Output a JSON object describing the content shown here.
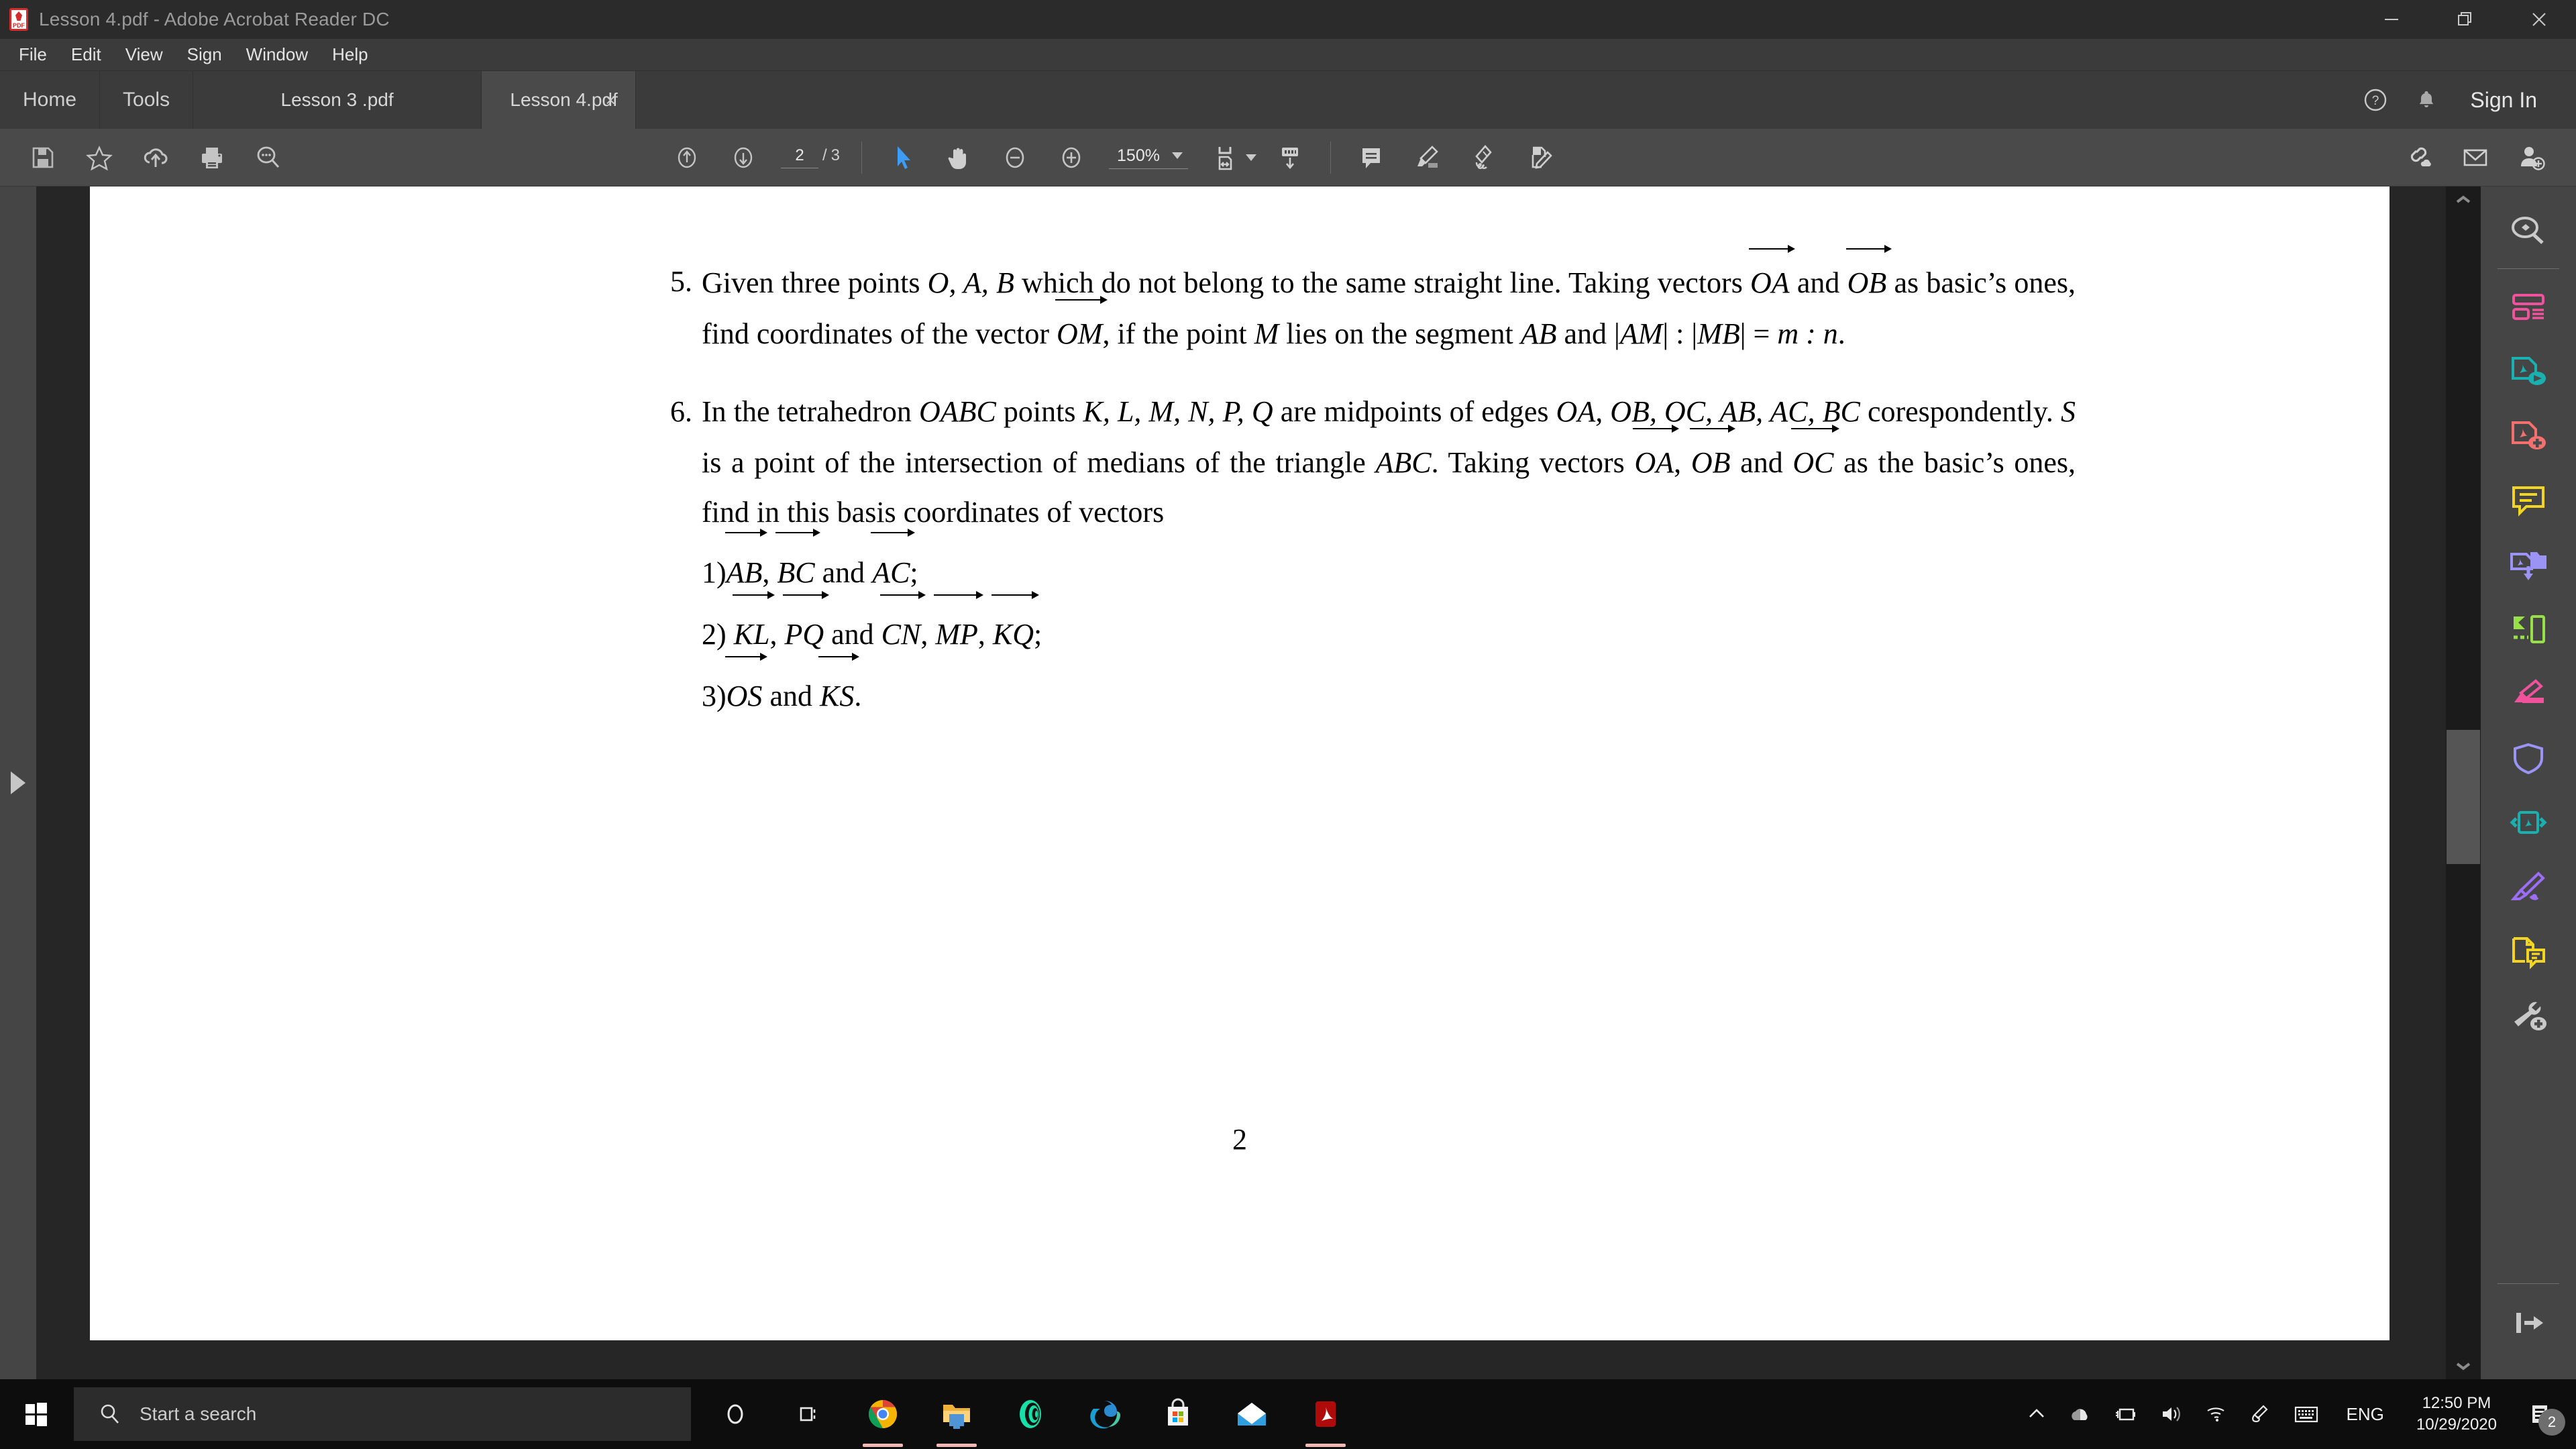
{
  "window": {
    "title": "Lesson 4.pdf - Adobe Acrobat Reader DC",
    "app_icon": "pdf-file-icon",
    "minimize_label": "—",
    "maximize_label": "❐",
    "close_label": "✕"
  },
  "menu": {
    "items": [
      "File",
      "Edit",
      "View",
      "Sign",
      "Window",
      "Help"
    ]
  },
  "tabs": {
    "home_label": "Home",
    "tools_label": "Tools",
    "documents": [
      {
        "label": "Lesson 3 .pdf",
        "active": false
      },
      {
        "label": "Lesson 4.pdf",
        "active": true,
        "close_label": "×"
      }
    ],
    "help_icon": "help-circle-icon",
    "bell_icon": "notification-bell-icon",
    "sign_in_label": "Sign In"
  },
  "toolbar": {
    "left_icons": [
      "save-icon",
      "star-icon",
      "cloud-upload-icon",
      "print-icon",
      "search-icon"
    ],
    "page_current": "2",
    "page_separator": "/",
    "page_total": "3",
    "nav_up_icon": "arrow-up-circle-icon",
    "nav_down_icon": "arrow-down-circle-icon",
    "select_tool_icon": "cursor-select-icon",
    "hand_tool_icon": "hand-pan-icon",
    "zoom_out_icon": "zoom-out-icon",
    "zoom_in_icon": "zoom-in-icon",
    "zoom_value": "150%",
    "fit_page_icon": "fit-page-icon",
    "scroll_mode_icon": "scroll-mode-icon",
    "comment_icon": "comment-icon",
    "highlight_icon": "highlighter-icon",
    "draw_icon": "sign-pen-icon",
    "fill_sign_icon": "fill-and-sign-icon",
    "share_link_icon": "share-link-icon",
    "email_icon": "email-icon",
    "add_person_icon": "add-person-icon"
  },
  "right_panel": {
    "tools": [
      {
        "name": "search-document-icon",
        "color": "#c9c9c9"
      },
      {
        "name": "export-pdf-icon",
        "color": "#f0529c"
      },
      {
        "name": "create-pdf-icon",
        "color": "#1ab0b0"
      },
      {
        "name": "edit-pdf-icon",
        "color": "#f2706d"
      },
      {
        "name": "comment-tool-icon",
        "color": "#f2d522"
      },
      {
        "name": "combine-files-icon",
        "color": "#9b94f5"
      },
      {
        "name": "organize-pages-icon",
        "color": "#98e048"
      },
      {
        "name": "redact-icon",
        "color": "#f0529c"
      },
      {
        "name": "protect-icon",
        "color": "#9b94f5"
      },
      {
        "name": "compress-pdf-icon",
        "color": "#1ab0b0"
      },
      {
        "name": "fill-sign-tool-icon",
        "color": "#9b6ef5"
      },
      {
        "name": "request-signature-icon",
        "color": "#f2d522"
      },
      {
        "name": "more-tools-icon",
        "color": "#c9c9c9"
      }
    ],
    "collapse_icon": "collapse-panel-icon"
  },
  "document": {
    "problems": [
      {
        "number": "5.",
        "segments": [
          {
            "t": "Given three points ",
            "k": "r"
          },
          {
            "t": "O, A, B",
            "k": "i"
          },
          {
            "t": " which do not belong to the same straight line. Taking vectors ",
            "k": "r"
          },
          {
            "t": "OA",
            "k": "v"
          },
          {
            "t": " and ",
            "k": "r"
          },
          {
            "t": "OB",
            "k": "v"
          },
          {
            "t": " as basic’s ones, find coordinates of the vector ",
            "k": "r"
          },
          {
            "t": "OM",
            "k": "v"
          },
          {
            "t": ", if the point ",
            "k": "r"
          },
          {
            "t": "M",
            "k": "i"
          },
          {
            "t": " lies on the segment ",
            "k": "r"
          },
          {
            "t": "AB",
            "k": "i"
          },
          {
            "t": " and |",
            "k": "r"
          },
          {
            "t": "AM",
            "k": "i"
          },
          {
            "t": "| : |",
            "k": "r"
          },
          {
            "t": "MB",
            "k": "i"
          },
          {
            "t": "| = ",
            "k": "r"
          },
          {
            "t": "m : n",
            "k": "i"
          },
          {
            "t": ".",
            "k": "r"
          }
        ]
      },
      {
        "number": "6.",
        "segments": [
          {
            "t": "In the tetrahedron ",
            "k": "r"
          },
          {
            "t": "OABC",
            "k": "i"
          },
          {
            "t": " points ",
            "k": "r"
          },
          {
            "t": "K, L, M, N, P, Q",
            "k": "i"
          },
          {
            "t": " are midpoints of edges ",
            "k": "r"
          },
          {
            "t": "OA, OB, OC, AB, AC, BC",
            "k": "i"
          },
          {
            "t": " corespondently. ",
            "k": "r"
          },
          {
            "t": "S",
            "k": "i"
          },
          {
            "t": " is a point of the intersection of medians of the triangle ",
            "k": "r"
          },
          {
            "t": "ABC",
            "k": "i"
          },
          {
            "t": ". Taking vectors ",
            "k": "r"
          },
          {
            "t": "OA",
            "k": "v"
          },
          {
            "t": ", ",
            "k": "r"
          },
          {
            "t": "OB",
            "k": "v"
          },
          {
            "t": " and ",
            "k": "r"
          },
          {
            "t": "OC",
            "k": "v"
          },
          {
            "t": " as the basic’s ones, find in this basis coordinates of vectors",
            "k": "r"
          }
        ],
        "subitems": [
          {
            "segments": [
              {
                "t": "1)",
                "k": "r"
              },
              {
                "t": "AB",
                "k": "v"
              },
              {
                "t": ", ",
                "k": "r"
              },
              {
                "t": "BC",
                "k": "v"
              },
              {
                "t": " and ",
                "k": "r"
              },
              {
                "t": "AC",
                "k": "v"
              },
              {
                "t": ";",
                "k": "r"
              }
            ]
          },
          {
            "segments": [
              {
                "t": "2) ",
                "k": "r"
              },
              {
                "t": "KL",
                "k": "v"
              },
              {
                "t": ", ",
                "k": "r"
              },
              {
                "t": "PQ",
                "k": "v"
              },
              {
                "t": " and ",
                "k": "r"
              },
              {
                "t": "CN",
                "k": "v"
              },
              {
                "t": ", ",
                "k": "r"
              },
              {
                "t": "MP",
                "k": "v"
              },
              {
                "t": ", ",
                "k": "r"
              },
              {
                "t": "KQ",
                "k": "v"
              },
              {
                "t": ";",
                "k": "r"
              }
            ]
          },
          {
            "segments": [
              {
                "t": "3)",
                "k": "r"
              },
              {
                "t": "OS",
                "k": "v"
              },
              {
                "t": " and ",
                "k": "r"
              },
              {
                "t": "KS",
                "k": "v"
              },
              {
                "t": ".",
                "k": "r"
              }
            ]
          }
        ]
      }
    ],
    "page_footer": "2"
  },
  "taskbar": {
    "start_icon": "windows-start-icon",
    "search_icon": "search-icon",
    "search_placeholder": "Start a search",
    "cortana_icon": "cortana-icon",
    "taskview_icon": "task-view-icon",
    "apps": [
      {
        "name": "chrome-icon",
        "running": true
      },
      {
        "name": "file-explorer-icon",
        "running": true
      },
      {
        "name": "spiral-app-icon",
        "running": false
      },
      {
        "name": "edge-icon",
        "running": false
      },
      {
        "name": "microsoft-store-icon",
        "running": false
      },
      {
        "name": "mail-icon",
        "running": false
      },
      {
        "name": "adobe-acrobat-icon",
        "running": true
      }
    ],
    "tray": {
      "chevron_icon": "show-hidden-icons-icon",
      "onedrive_icon": "onedrive-icon",
      "battery_icon": "battery-charging-icon",
      "volume_icon": "volume-icon",
      "wifi_icon": "wifi-icon",
      "bluetooth_pen_icon": "pen-bluetooth-icon",
      "keyboard_icon": "touch-keyboard-icon",
      "language": "ENG",
      "time": "12:50 PM",
      "date": "10/29/2020",
      "notifications_icon": "action-center-icon",
      "notifications_count": "2"
    }
  }
}
